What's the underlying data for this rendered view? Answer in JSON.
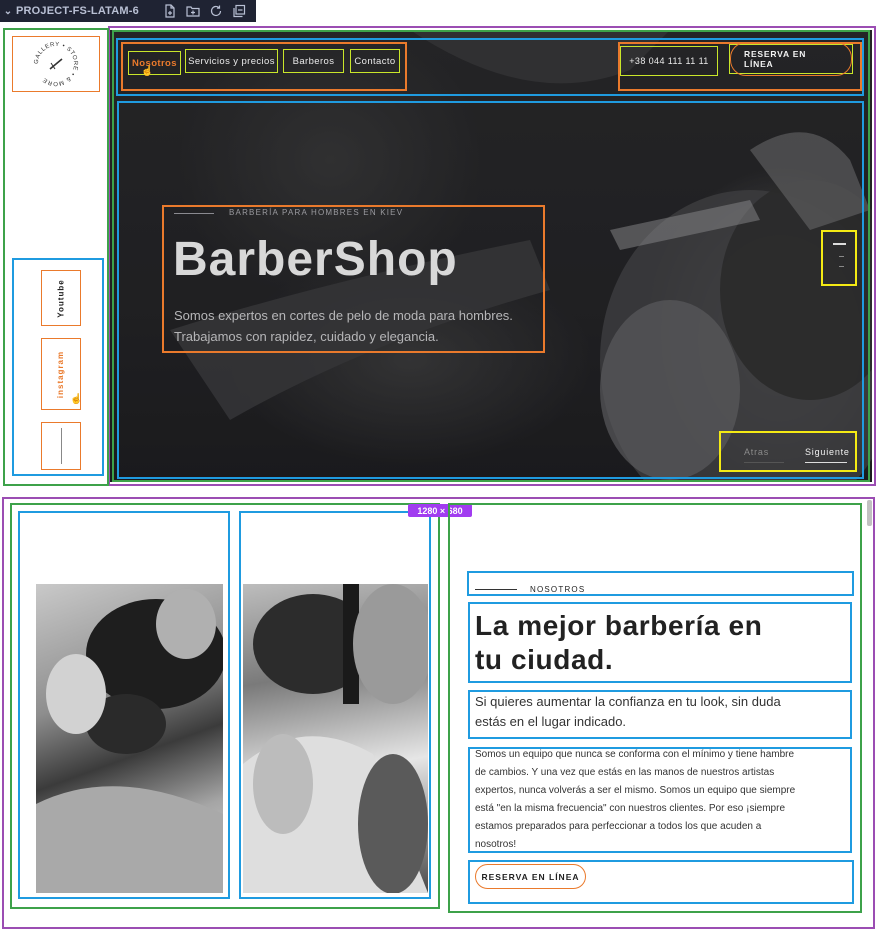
{
  "editor": {
    "project_name": "PROJECT-FS-LATAM-6",
    "icons": [
      "new-file-icon",
      "new-folder-icon",
      "refresh-icon",
      "collapse-icon"
    ]
  },
  "sidebar": {
    "logo_text": "GALLERY • STORE • & MORE",
    "social": [
      {
        "label": "Youtube",
        "active": false
      },
      {
        "label": "instagram",
        "active": true
      }
    ]
  },
  "hero": {
    "nav": [
      "Nosotros",
      "Servicios y precios",
      "Barberos",
      "Contacto"
    ],
    "active_nav": "Nosotros",
    "phone": "+38 044 111 11 11",
    "cta": "RESERVA EN LÍNEA",
    "kicker": "BARBERÍA PARA HOMBRES EN KIEV",
    "title": "BarberShop",
    "subtitle_line1": "Somos expertos en cortes de pelo de moda para hombres.",
    "subtitle_line2": "Trabajamos con rapidez, cuidado y elegancia.",
    "slider_prev": "Atras",
    "slider_next": "Siguiente"
  },
  "viewport_badge": "1280 × 680",
  "about": {
    "kicker": "NOSOTROS",
    "title_line1": "La mejor barbería en",
    "title_line2": "tu ciudad.",
    "lead_line1": "Si quieres aumentar la confianza en tu look, sin duda",
    "lead_line2": "estás en el lugar indicado.",
    "body_lines": [
      "Somos un equipo que nunca se conforma con el mínimo y tiene hambre",
      "de cambios. Y una vez que estás en las manos de nuestros artistas",
      "expertos, nunca volverás a ser el mismo. Somos un equipo que siempre",
      "está \"en la misma frecuencia\" con nuestros clientes. Por eso ¡siempre",
      "estamos preparados para perfeccionar a todos los que acuden a",
      "nosotros!"
    ],
    "cta": "RESERVA EN LÍNEA"
  },
  "colors": {
    "accent": "#ea7a2c",
    "frame_purple": "#9b4db3",
    "frame_green": "#3da24a",
    "frame_blue": "#1f9be0",
    "frame_yellow": "#f4ea14",
    "badge": "#a13cf0"
  }
}
